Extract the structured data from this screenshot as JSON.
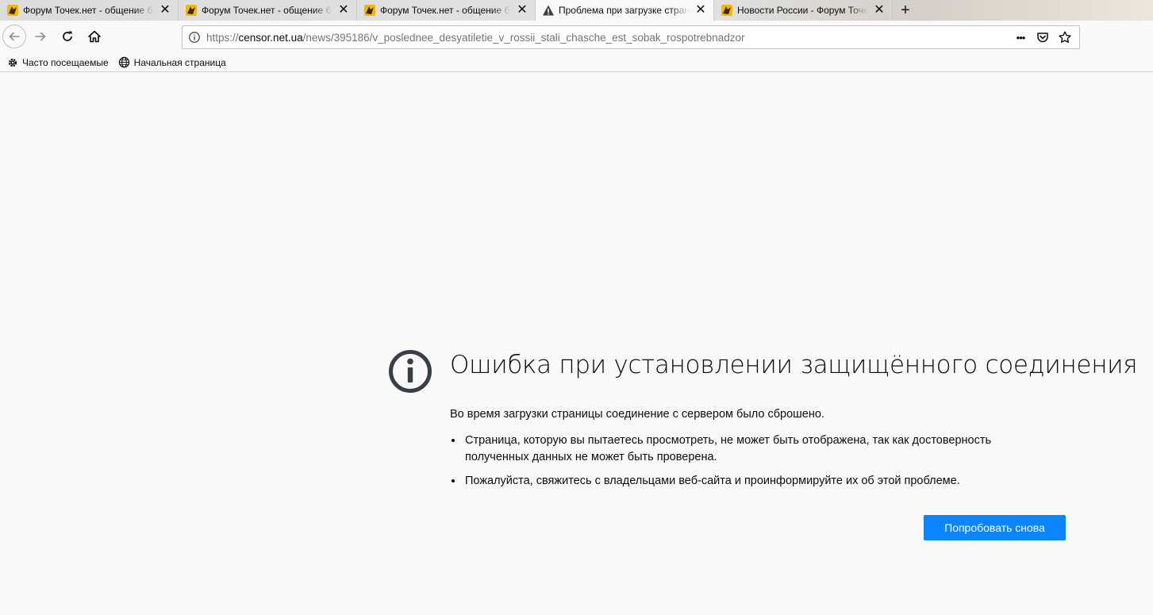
{
  "tabs": [
    {
      "title": "Форум Точек.нет - общение б",
      "favicon": "forum-favicon-icon",
      "active": false
    },
    {
      "title": "Форум Точек.нет - общение б",
      "favicon": "forum-favicon-icon",
      "active": false
    },
    {
      "title": "Форум Точек.нет - общение б",
      "favicon": "forum-favicon-icon",
      "active": false
    },
    {
      "title": "Проблема при загрузке стран",
      "favicon": "warning-icon",
      "active": true
    },
    {
      "title": "Новости России - Форум Точе",
      "favicon": "forum-favicon-icon",
      "active": false
    }
  ],
  "newtab_label": "+",
  "close_glyph": "✕",
  "url": {
    "prefix": "https://",
    "host": "censor.net.ua",
    "path": "/news/395186/v_poslednee_desyatiletie_v_rossii_stali_chasche_est_sobak_rospotrebnadzor"
  },
  "url_actions": {
    "more": "•••"
  },
  "bookmarks": [
    {
      "label": "Часто посещаемые",
      "icon": "gear-icon"
    },
    {
      "label": "Начальная страница",
      "icon": "globe-icon"
    }
  ],
  "error": {
    "title": "Ошибка при установлении защищённого соединения",
    "intro": "Во время загрузки страницы соединение с сервером было сброшено.",
    "bullets": [
      "Страница, которую вы пытаетесь просмотреть, не может быть отображена, так как достоверность полученных данных не может быть проверена.",
      "Пожалуйста, свяжитесь с владельцами веб-сайта и проинформируйте их об этой проблеме."
    ],
    "retry_label": "Попробовать снова"
  },
  "colors": {
    "accent": "#0a84ff",
    "icon": "#3a3e47",
    "text": "#0c0c0d"
  }
}
